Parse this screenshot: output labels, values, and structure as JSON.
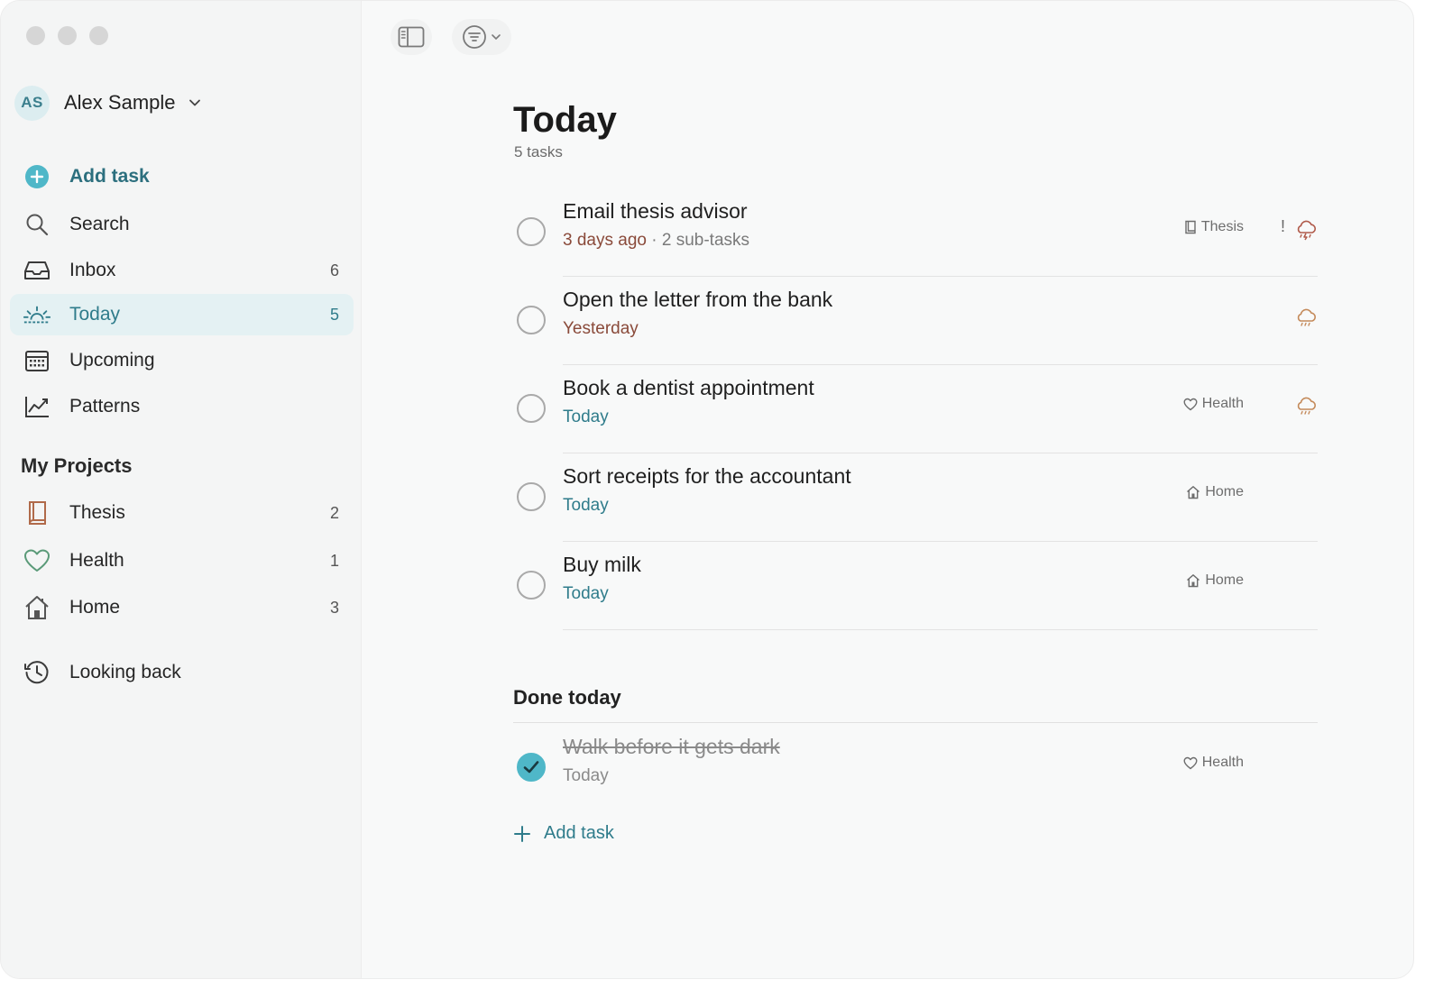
{
  "account": {
    "initials": "AS",
    "name": "Alex Sample"
  },
  "nav": {
    "add_task": "Add task",
    "search": "Search",
    "inbox": {
      "label": "Inbox",
      "count": "6"
    },
    "today": {
      "label": "Today",
      "count": "5"
    },
    "upcoming": "Upcoming",
    "patterns": "Patterns"
  },
  "projects": {
    "title": "My Projects",
    "items": [
      {
        "label": "Thesis",
        "count": "2"
      },
      {
        "label": "Health",
        "count": "1"
      },
      {
        "label": "Home",
        "count": "3"
      }
    ]
  },
  "looking_back": "Looking back",
  "main": {
    "title": "Today",
    "subtitle": "5 tasks",
    "tasks": [
      {
        "title": "Email thesis advisor",
        "date": "3 days ago",
        "sep": " · ",
        "subtasks": "2 sub-tasks",
        "tag": "Thesis",
        "flag": "!"
      },
      {
        "title": "Open the letter from the bank",
        "date": "Yesterday"
      },
      {
        "title": "Book a dentist appointment",
        "date": "Today",
        "tag": "Health"
      },
      {
        "title": "Sort receipts for the accountant",
        "date": "Today",
        "tag": "Home"
      },
      {
        "title": "Buy milk",
        "date": "Today",
        "tag": "Home"
      }
    ],
    "done_title": "Done today",
    "done": [
      {
        "title": "Walk before it gets dark",
        "date": "Today",
        "tag": "Health"
      }
    ],
    "add_task": "Add task"
  },
  "colors": {
    "accent": "#2f7c8b",
    "active_bg": "#e4f1f3",
    "check_done": "#4fb7c8",
    "overdue": "#8a4a3a",
    "weather": "#c48a5a"
  }
}
